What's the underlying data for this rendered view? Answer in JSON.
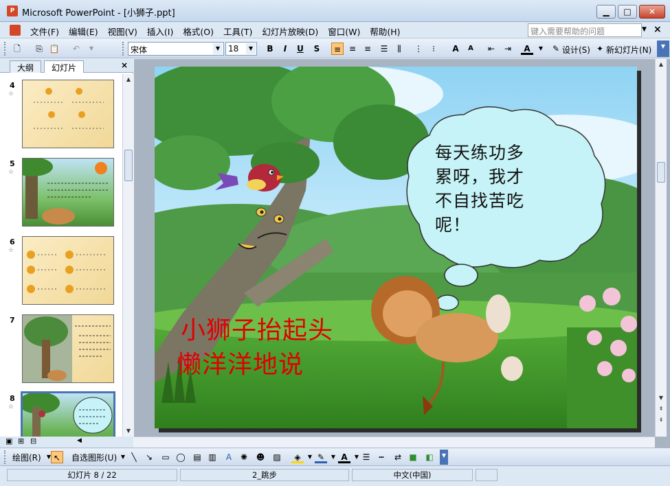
{
  "window": {
    "title": "Microsoft PowerPoint - [小狮子.ppt]",
    "app_icon": "P",
    "minimize": "▁",
    "maximize": "□",
    "close": "✕"
  },
  "menu": {
    "items": [
      "文件(F)",
      "编辑(E)",
      "视图(V)",
      "插入(I)",
      "格式(O)",
      "工具(T)",
      "幻灯片放映(D)",
      "窗口(W)",
      "帮助(H)"
    ],
    "help_placeholder": "键入需要帮助的问题",
    "close": "×"
  },
  "toolbar": {
    "font_name": "宋体",
    "font_size": "18",
    "bold": "B",
    "italic": "I",
    "underline": "U",
    "shadow": "S",
    "design": "设计(S)",
    "new_slide": "新幻灯片(N)"
  },
  "left_pane": {
    "tab_outline": "大纲",
    "tab_slides": "幻灯片",
    "close": "×",
    "slides": [
      {
        "number": "4"
      },
      {
        "number": "5"
      },
      {
        "number": "6"
      },
      {
        "number": "7"
      },
      {
        "number": "8"
      }
    ]
  },
  "slide": {
    "speech_bubble": [
      "每天练功多",
      "累呀，我才",
      "不自找苦吃",
      "呢！"
    ],
    "caption_line1": "小狮子抬起头",
    "caption_line2": "懒洋洋地说"
  },
  "drawing_toolbar": {
    "draw": "绘图(R)",
    "autoshapes": "自选图形(U)"
  },
  "status": {
    "slide_indicator": "幻灯片 8 / 22",
    "design_name": "2_跳步",
    "language": "中文(中国)"
  },
  "colors": {
    "caption": "#e00000",
    "bubble_fill": "#c6f3f7",
    "selection": "#4873b6"
  }
}
